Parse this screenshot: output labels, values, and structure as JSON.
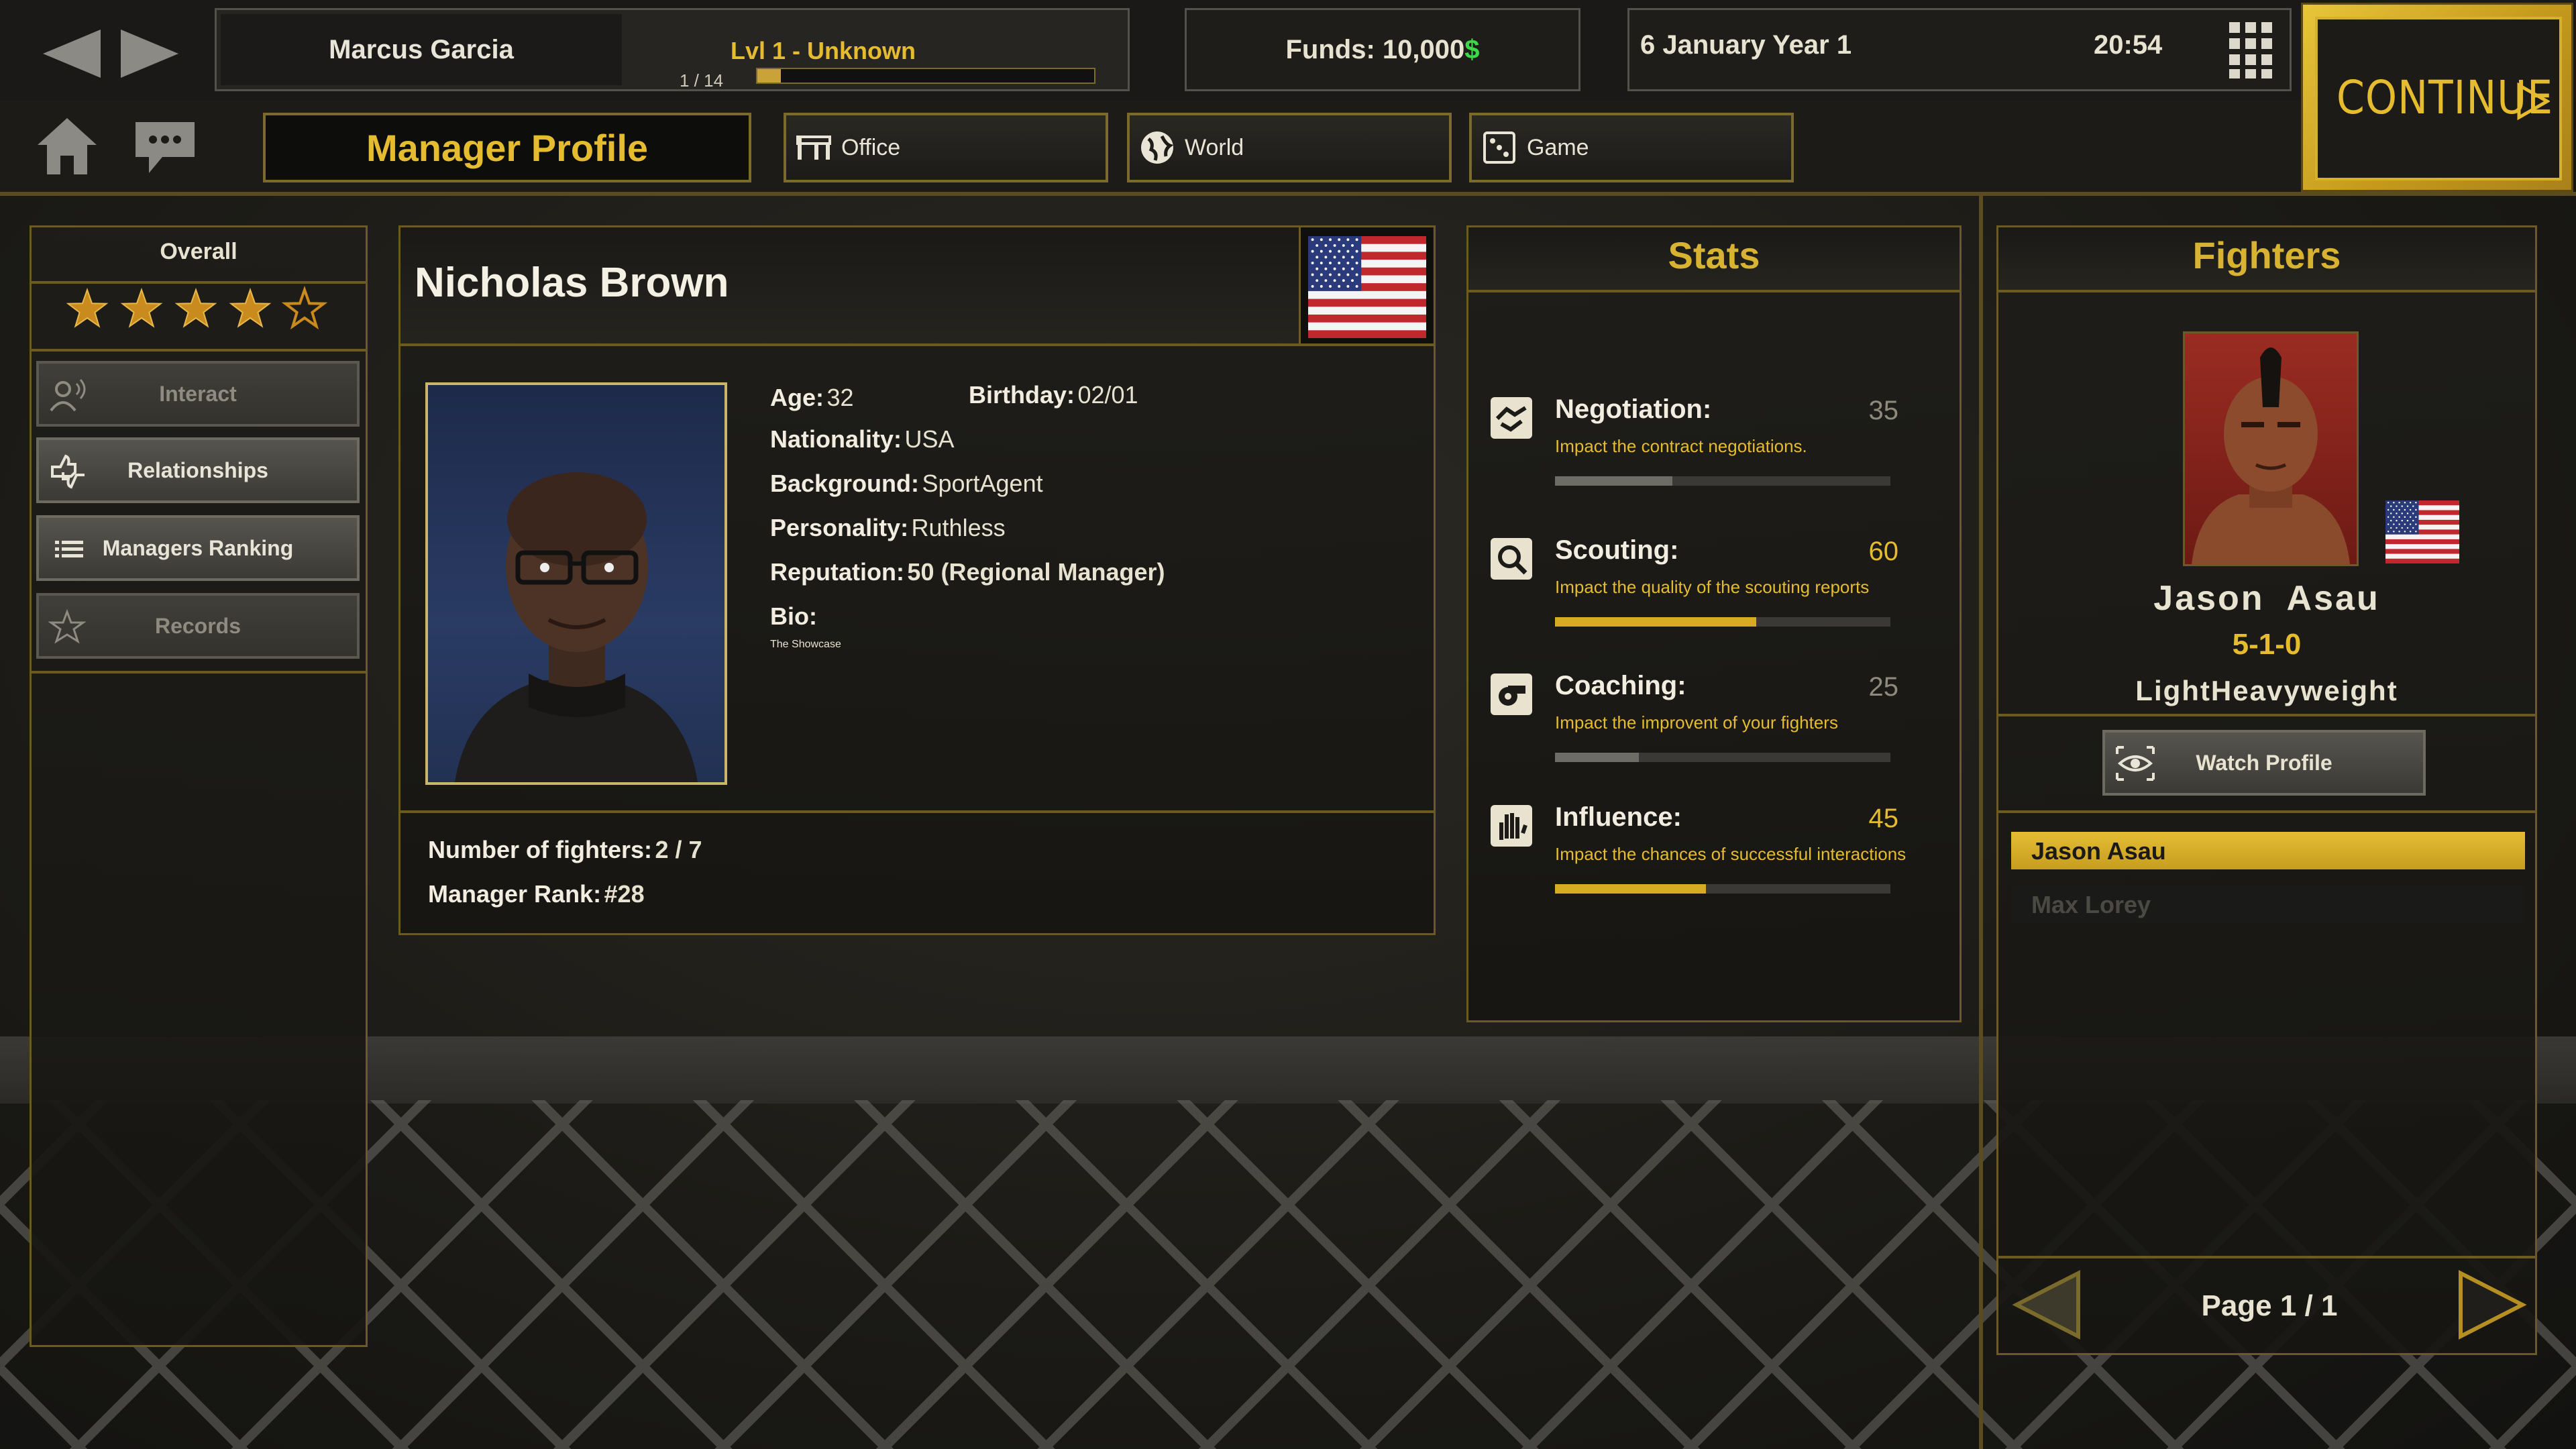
{
  "topbar": {
    "manager_name": "Marcus Garcia",
    "level": "Lvl 1 - Unknown",
    "xp": "1 / 14",
    "xp_progress": 0.07,
    "funds_label": "Funds: 10,000",
    "funds_currency": "$",
    "date": "6 January Year 1",
    "time": "20:54",
    "continue": "CONTINUE"
  },
  "nav": {
    "page_title": "Manager Profile",
    "tabs": [
      {
        "label": "Office",
        "icon": "office-icon"
      },
      {
        "label": "World",
        "icon": "globe-icon"
      },
      {
        "label": "Game",
        "icon": "dice-icon"
      }
    ]
  },
  "sidebar": {
    "overall_label": "Overall",
    "rating": 4,
    "rating_max": 5,
    "items": [
      {
        "label": "Interact",
        "enabled": false
      },
      {
        "label": "Relationships",
        "enabled": true
      },
      {
        "label": "Managers Ranking",
        "enabled": true
      },
      {
        "label": "Records",
        "enabled": false
      }
    ]
  },
  "profile": {
    "name": "Nicholas Brown",
    "flag": "usa-flag",
    "age_label": "Age:",
    "age": "32",
    "birthday_label": "Birthday:",
    "birthday": "02/01",
    "nationality_label": "Nationality:",
    "nationality": "USA",
    "background_label": "Background:",
    "background": "SportAgent",
    "personality_label": "Personality:",
    "personality": "Ruthless",
    "reputation_label": "Reputation:",
    "reputation": "50 (Regional Manager)",
    "bio_label": "Bio:",
    "bio": "The Showcase",
    "fighters_label": "Number of fighters:",
    "fighters": "2 / 7",
    "rank_label": "Manager Rank:",
    "rank": "#28"
  },
  "stats": {
    "title": "Stats",
    "items": [
      {
        "name": "Negotiation:",
        "value": "35",
        "desc": "Impact the contract negotiations.",
        "progress": 0.35,
        "highlight": false,
        "icon": "handshake-icon"
      },
      {
        "name": "Scouting:",
        "value": "60",
        "desc": "Impact the quality of the scouting reports",
        "progress": 0.6,
        "highlight": true,
        "icon": "magnifier-icon"
      },
      {
        "name": "Coaching:",
        "value": "25",
        "desc": "Impact the improvent of your fighters",
        "progress": 0.25,
        "highlight": false,
        "icon": "whistle-icon"
      },
      {
        "name": "Influence:",
        "value": "45",
        "desc": "Impact the chances of successful interactions",
        "progress": 0.45,
        "highlight": true,
        "icon": "hand-icon"
      }
    ]
  },
  "fighters": {
    "title": "Fighters",
    "selected": {
      "first": "Jason",
      "last": "Asau",
      "record": "5-1-0",
      "weight_class": "LightHeavyweight",
      "flag": "usa-flag"
    },
    "watch_profile": "Watch Profile",
    "list": [
      {
        "name": "Jason  Asau",
        "selected": true
      },
      {
        "name": "Max Lorey",
        "selected": false
      }
    ],
    "page": "Page 1 / 1"
  },
  "colors": {
    "gold": "#e5bb2f",
    "green": "#3bd94a",
    "border": "#6b5a22"
  }
}
